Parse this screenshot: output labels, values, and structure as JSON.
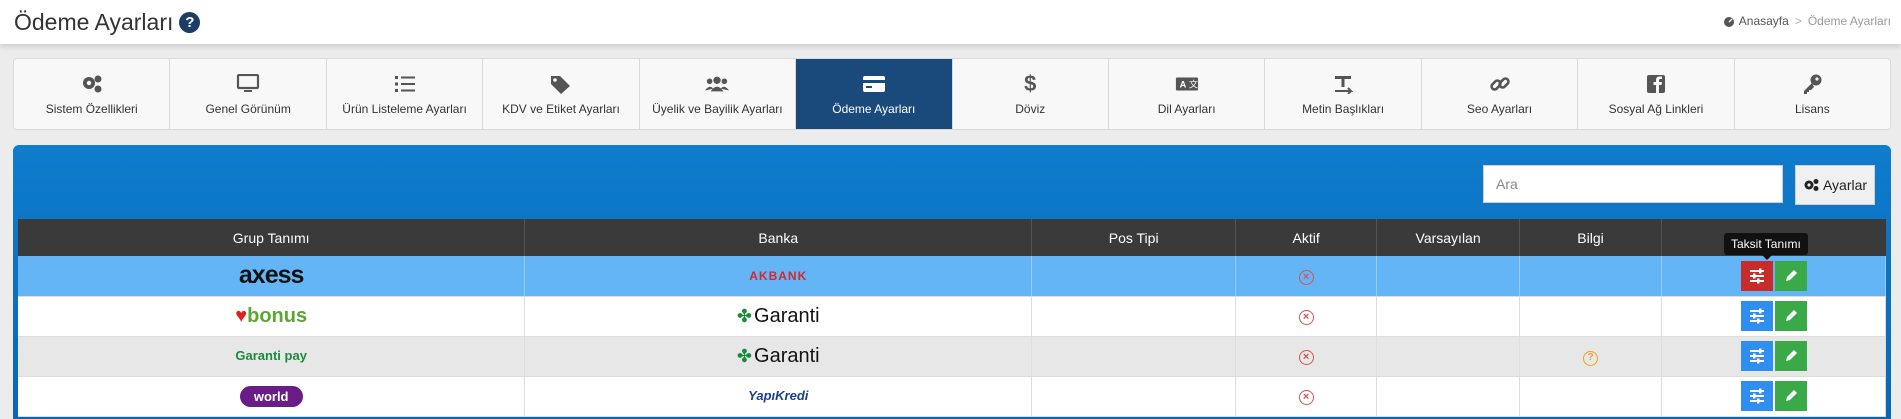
{
  "header": {
    "title": "Ödeme Ayarları",
    "help_glyph": "?",
    "breadcrumb": {
      "home": "Anasayfa",
      "separator": ">",
      "current": "Ödeme Ayarları"
    }
  },
  "tabs": [
    {
      "label": "Sistem Özellikleri",
      "icon": "cogs-icon"
    },
    {
      "label": "Genel Görünüm",
      "icon": "monitor-icon"
    },
    {
      "label": "Ürün Listeleme Ayarları",
      "icon": "list-icon"
    },
    {
      "label": "KDV ve Etiket Ayarları",
      "icon": "tags-icon"
    },
    {
      "label": "Üyelik ve Bayilik Ayarları",
      "icon": "users-icon"
    },
    {
      "label": "Ödeme Ayarları",
      "icon": "credit-card-icon",
      "active": true
    },
    {
      "label": "Döviz",
      "icon": "dollar-icon"
    },
    {
      "label": "Dil Ayarları",
      "icon": "language-icon"
    },
    {
      "label": "Metin Başlıkları",
      "icon": "text-height-icon"
    },
    {
      "label": "Seo Ayarları",
      "icon": "link-icon"
    },
    {
      "label": "Sosyal Ağ Linkleri",
      "icon": "facebook-icon"
    },
    {
      "label": "Lisans",
      "icon": "key-icon"
    }
  ],
  "toolbar": {
    "search_placeholder": "Ara",
    "settings_label": "Ayarlar"
  },
  "table": {
    "columns": [
      "Grup Tanımı",
      "Banka",
      "Pos Tipi",
      "Aktif",
      "Varsayılan",
      "Bilgi",
      ""
    ],
    "rows": [
      {
        "group": "axess",
        "bank": "AKBANK",
        "pos_type": "",
        "active": "inactive",
        "info": ""
      },
      {
        "group": "bonus",
        "bank": "Garanti",
        "pos_type": "",
        "active": "inactive",
        "info": ""
      },
      {
        "group": "Garanti pay",
        "bank": "Garanti",
        "pos_type": "",
        "active": "inactive",
        "info": "question"
      },
      {
        "group": "world",
        "bank": "YapıKredi",
        "pos_type": "",
        "active": "inactive",
        "info": ""
      }
    ]
  },
  "tooltip": "Taksit Tanımı",
  "colors": {
    "accent": "#1a4a7c",
    "panel": "#0a6fc0",
    "selected_row": "#63b5f5",
    "edit": "#3aaa49",
    "tune": "#2e8ff0"
  }
}
